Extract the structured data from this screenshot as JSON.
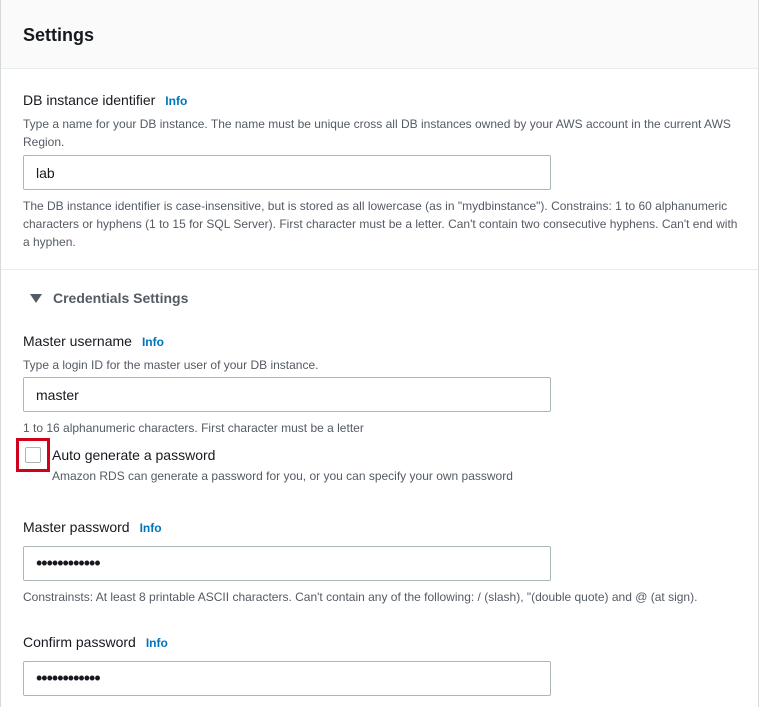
{
  "panel": {
    "title": "Settings"
  },
  "db_identifier": {
    "label": "DB instance identifier",
    "info": "Info",
    "description": "Type a name for your DB instance. The name must be unique cross all DB instances owned by your AWS account in the current AWS Region.",
    "value": "lab",
    "constraints": "The DB instance identifier is case-insensitive, but is stored as all lowercase (as in \"mydbinstance\"). Constrains: 1 to 60 alphanumeric characters or hyphens (1 to 15 for SQL Server). First character must be a letter. Can't contain two consecutive hyphens. Can't end with a hyphen."
  },
  "credentials": {
    "section_label": "Credentials Settings",
    "master_username": {
      "label": "Master username",
      "info": "Info",
      "description": "Type a login ID for the master user of your DB instance.",
      "value": "master",
      "constraints": "1 to 16 alphanumeric characters. First character must be a letter"
    },
    "auto_generate": {
      "label": "Auto generate a password",
      "description": "Amazon RDS can generate a password for you, or you can specify your own password",
      "checked": false,
      "highlight_color": "#d0021b"
    },
    "master_password": {
      "label": "Master password",
      "info": "Info",
      "value": "••••••••••••",
      "constraints": "Constrainsts: At least 8 printable ASCII characters. Can't contain any of the following: / (slash), \"(double quote) and @ (at sign)."
    },
    "confirm_password": {
      "label": "Confirm password",
      "info": "Info",
      "value": "••••••••••••"
    }
  },
  "colors": {
    "info_link": "#0073bb",
    "header_bg": "#fafafa",
    "input_border": "#aab7b8",
    "secondary_text": "#545b64"
  }
}
